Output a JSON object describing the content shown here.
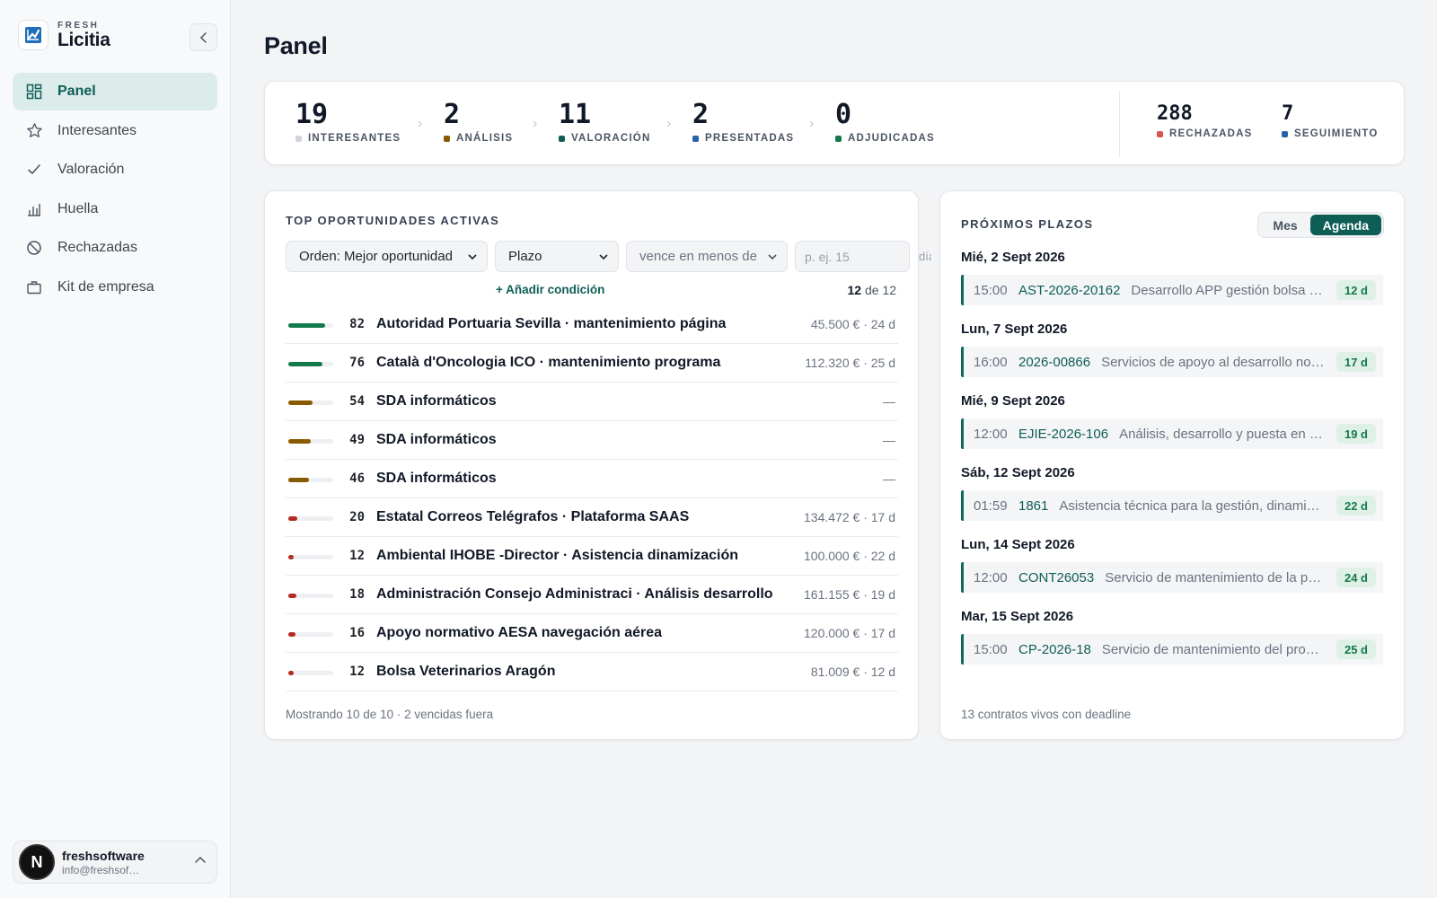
{
  "brand": {
    "sub": "FRESH",
    "name": "Licitia"
  },
  "nav": [
    {
      "label": "Panel",
      "icon": "dashboard-icon",
      "active": true
    },
    {
      "label": "Interesantes",
      "icon": "star-icon",
      "active": false
    },
    {
      "label": "Valoración",
      "icon": "check-icon",
      "active": false
    },
    {
      "label": "Huella",
      "icon": "bar-chart-icon",
      "active": false
    },
    {
      "label": "Rechazadas",
      "icon": "ban-icon",
      "active": false
    },
    {
      "label": "Kit de empresa",
      "icon": "briefcase-icon",
      "active": false
    }
  ],
  "user": {
    "initial": "N",
    "name": "freshsoftware",
    "email": "info@freshsof…"
  },
  "page": {
    "title": "Panel"
  },
  "stats": {
    "pipeline": [
      {
        "value": "19",
        "label": "INTERESANTES",
        "color": "#d1d5db"
      },
      {
        "value": "2",
        "label": "ANÁLISIS",
        "color": "#8a5a00"
      },
      {
        "value": "11",
        "label": "VALORACIÓN",
        "color": "#0f5e56"
      },
      {
        "value": "2",
        "label": "PRESENTADAS",
        "color": "#2563a8"
      },
      {
        "value": "0",
        "label": "ADJUDICADAS",
        "color": "#137a4c"
      }
    ],
    "side": [
      {
        "value": "288",
        "label": "RECHAZADAS",
        "color": "#d9534f"
      },
      {
        "value": "7",
        "label": "SEGUIMIENTO",
        "color": "#2563a8"
      }
    ]
  },
  "opportunities": {
    "title": "TOP OPORTUNIDADES ACTIVAS",
    "sort_label": "Orden: Mejor oportunidad",
    "field_label": "Plazo",
    "operator_label": "vence en menos de",
    "value_placeholder": "p. ej. 15",
    "unit_label": "días",
    "add_condition": "+ Añadir condición",
    "count_shown": "12",
    "count_total": "de 12",
    "footer": "Mostrando 10 de 10 · 2 vencidas fuera",
    "rows": [
      {
        "score": "82",
        "title": "Autoridad Portuaria Sevilla · mantenimiento página",
        "meta": "45.500 € · 24 d",
        "fill": 0.82,
        "color": "#137a4c"
      },
      {
        "score": "76",
        "title": "Català d'Oncologia ICO · mantenimiento programa",
        "meta": "112.320 € · 25 d",
        "fill": 0.76,
        "color": "#137a4c"
      },
      {
        "score": "54",
        "title": "SDA informáticos",
        "meta": "—",
        "fill": 0.54,
        "color": "#8a5a00"
      },
      {
        "score": "49",
        "title": "SDA informáticos",
        "meta": "—",
        "fill": 0.49,
        "color": "#8a5a00"
      },
      {
        "score": "46",
        "title": "SDA informáticos",
        "meta": "—",
        "fill": 0.46,
        "color": "#8a5a00"
      },
      {
        "score": "20",
        "title": "Estatal Correos Telégrafos · Plataforma SAAS",
        "meta": "134.472 € · 17 d",
        "fill": 0.2,
        "color": "#b32b23"
      },
      {
        "score": "12",
        "title": "Ambiental IHOBE -Director · Asistencia dinamización",
        "meta": "100.000 € · 22 d",
        "fill": 0.12,
        "color": "#b32b23"
      },
      {
        "score": "18",
        "title": "Administración Consejo Administraci · Análisis desarrollo",
        "meta": "161.155 € · 19 d",
        "fill": 0.18,
        "color": "#b32b23"
      },
      {
        "score": "16",
        "title": "Apoyo normativo AESA navegación aérea",
        "meta": "120.000 € · 17 d",
        "fill": 0.16,
        "color": "#b32b23"
      },
      {
        "score": "12",
        "title": "Bolsa Veterinarios Aragón",
        "meta": "81.009 € · 12 d",
        "fill": 0.12,
        "color": "#b32b23"
      }
    ]
  },
  "deadlines": {
    "title": "PRÓXIMOS PLAZOS",
    "toggle": {
      "month": "Mes",
      "agenda": "Agenda"
    },
    "footer": "13 contratos vivos con deadline",
    "groups": [
      {
        "date": "Mié, 2 Sept 2026",
        "time": "15:00",
        "code": "AST-2026-20162",
        "desc": "Desarrollo APP gestión bolsa de empleo",
        "badge": "12 d"
      },
      {
        "date": "Lun, 7 Sept 2026",
        "time": "16:00",
        "code": "2026-00866",
        "desc": "Servicios de apoyo al desarrollo normativo",
        "badge": "17 d"
      },
      {
        "date": "Mié, 9 Sept 2026",
        "time": "12:00",
        "code": "EJIE-2026-106",
        "desc": "Análisis, desarrollo y puesta en marcha",
        "badge": "19 d"
      },
      {
        "date": "Sáb, 12 Sept 2026",
        "time": "01:59",
        "code": "1861",
        "desc": "Asistencia técnica para la gestión, dinamización",
        "badge": "22 d"
      },
      {
        "date": "Lun, 14 Sept 2026",
        "time": "12:00",
        "code": "CONT26053",
        "desc": "Servicio de mantenimiento de la página web",
        "badge": "24 d"
      },
      {
        "date": "Mar, 15 Sept 2026",
        "time": "15:00",
        "code": "CP-2026-18",
        "desc": "Servicio de mantenimiento del programa",
        "badge": "25 d"
      }
    ]
  }
}
